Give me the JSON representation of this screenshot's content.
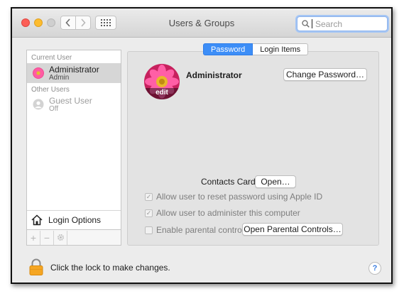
{
  "window": {
    "title": "Users & Groups"
  },
  "search": {
    "placeholder": "Search"
  },
  "sidebar": {
    "current_user_section": "Current User",
    "current_user": {
      "name": "Administrator",
      "role": "Admin"
    },
    "other_users_section": "Other Users",
    "guest_user": {
      "name": "Guest User",
      "status": "Off"
    },
    "login_options": "Login Options",
    "toolbar": {
      "add": "+",
      "remove": "−"
    }
  },
  "tabs": {
    "password": "Password",
    "login_items": "Login Items"
  },
  "user": {
    "name": "Administrator",
    "edit_label": "edit",
    "change_password_button": "Change Password…"
  },
  "contacts": {
    "label": "Contacts Card:",
    "open_button": "Open…"
  },
  "options": {
    "reset_password": {
      "label": "Allow user to reset password using Apple ID",
      "checked": true
    },
    "administer": {
      "label": "Allow user to administer this computer",
      "checked": true
    },
    "parental": {
      "label": "Enable parental controls",
      "checked": false
    },
    "open_parental_button": "Open Parental Controls…"
  },
  "footer": {
    "lock_text": "Click the lock to make changes.",
    "help": "?"
  },
  "colors": {
    "accent": "#3d8ef7",
    "lock": "#f5a623"
  }
}
